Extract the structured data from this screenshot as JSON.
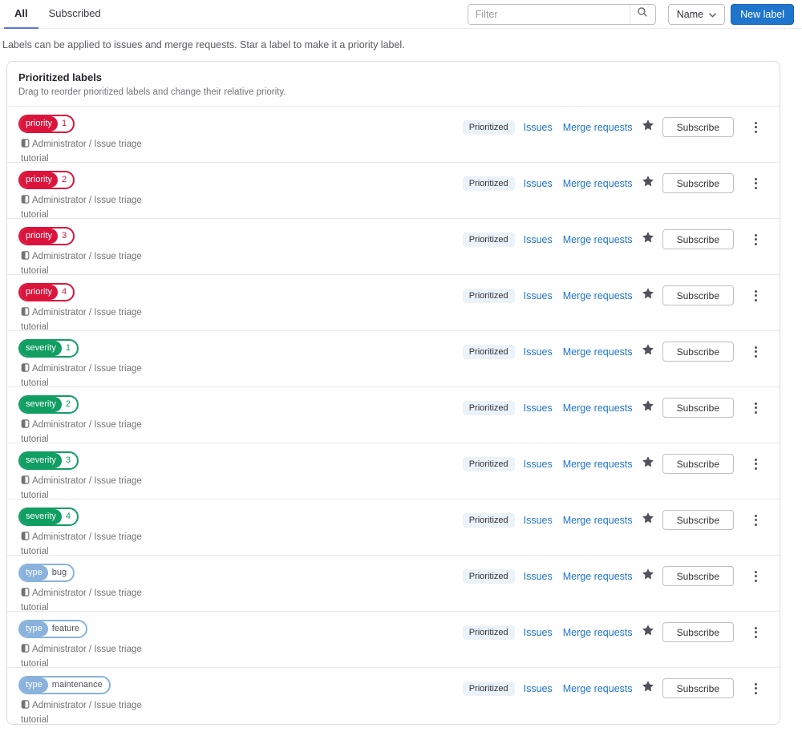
{
  "tabs": {
    "all": "All",
    "subscribed": "Subscribed"
  },
  "toolbar": {
    "filter_placeholder": "Filter",
    "sort_button": "Name",
    "new_label_button": "New label"
  },
  "page": {
    "description": "Labels can be applied to issues and merge requests. Star a label to make it a priority label."
  },
  "prioritized_card": {
    "title": "Prioritized labels",
    "subtitle": "Drag to reorder prioritized labels and change their relative priority."
  },
  "row_strings": {
    "project": "Administrator / Issue triage tutorial",
    "prioritized_badge": "Prioritized",
    "issues_link": "Issues",
    "merge_requests_link": "Merge requests",
    "subscribe_button": "Subscribe"
  },
  "icons": {
    "search": "magnifier-icon",
    "sort_chevron": "chevron-down-icon",
    "project": "project-icon",
    "star": "star-filled-icon",
    "more": "vertical-ellipsis-icon"
  },
  "colors": {
    "accent_blue": "#1f75cb",
    "tab_indicator": "#5c7ad6",
    "link": "#1f75cb",
    "priority_red": "#dc143c",
    "severity_green": "#109e62",
    "type_blue": "#89b2dd",
    "prioritized_badge_bg": "#ebf2fa"
  },
  "labels": [
    {
      "scope": "priority",
      "value": "1",
      "color": "#dc143c",
      "value_color": "#dc143c"
    },
    {
      "scope": "priority",
      "value": "2",
      "color": "#dc143c",
      "value_color": "#dc143c"
    },
    {
      "scope": "priority",
      "value": "3",
      "color": "#dc143c",
      "value_color": "#dc143c"
    },
    {
      "scope": "priority",
      "value": "4",
      "color": "#dc143c",
      "value_color": "#dc143c"
    },
    {
      "scope": "severity",
      "value": "1",
      "color": "#109e62",
      "value_color": "#109e62"
    },
    {
      "scope": "severity",
      "value": "2",
      "color": "#109e62",
      "value_color": "#109e62"
    },
    {
      "scope": "severity",
      "value": "3",
      "color": "#109e62",
      "value_color": "#109e62"
    },
    {
      "scope": "severity",
      "value": "4",
      "color": "#109e62",
      "value_color": "#109e62"
    },
    {
      "scope": "type",
      "value": "bug",
      "color": "#89b2dd",
      "value_color": "#535158"
    },
    {
      "scope": "type",
      "value": "feature",
      "color": "#89b2dd",
      "value_color": "#535158"
    },
    {
      "scope": "type",
      "value": "maintenance",
      "color": "#89b2dd",
      "value_color": "#535158"
    }
  ]
}
